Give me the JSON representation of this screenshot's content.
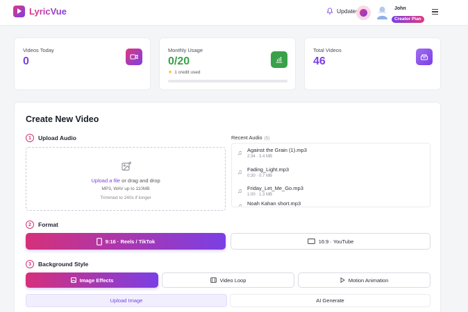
{
  "app": {
    "name": "LyricVue"
  },
  "header": {
    "updates_label": "Updates",
    "user_name": "John",
    "plan": "Creator Plan"
  },
  "stats": [
    {
      "label": "Videos Today",
      "value": "0"
    },
    {
      "label": "Monthly Usage",
      "value": "0/20",
      "note": "1 credit used",
      "progress": 0.0
    },
    {
      "label": "Total Videos",
      "value": "46"
    }
  ],
  "create": {
    "title": "Create New Video",
    "upload": {
      "step": "1",
      "title": "Upload Audio",
      "link_text": "Upload a file",
      "drop_text": "or drag and drop",
      "formats": "MP3, WAV up to 110MB",
      "trim_note": "Trimmed to 240s if longer"
    },
    "recent": {
      "title": "Recent Audio",
      "count": "(5)",
      "items": [
        {
          "name": "Against the Grain (1).mp3",
          "duration": "2:34",
          "size": "3.4 MB"
        },
        {
          "name": "Fading_Light.mp3",
          "duration": "0:30",
          "size": "0.7 MB"
        },
        {
          "name": "Friday_Let_Me_Go.mp3",
          "duration": "1:00",
          "size": "1.3 MB"
        },
        {
          "name": "Noah Kahan short.mp3",
          "duration": "",
          "size": ""
        }
      ]
    },
    "format": {
      "step": "2",
      "title": "Format",
      "options": [
        "9:16 · Reels / TikTok",
        "16:9 · YouTube"
      ]
    },
    "background": {
      "step": "3",
      "title": "Background Style",
      "options": [
        "Image Effects",
        "Video Loop",
        "Motion Animation"
      ],
      "sources": [
        "Upload Image",
        "AI Generate"
      ]
    }
  },
  "colors": {
    "accent_pink": "#d6307a",
    "accent_purple": "#7b3fe4",
    "success": "#3aa14a"
  }
}
